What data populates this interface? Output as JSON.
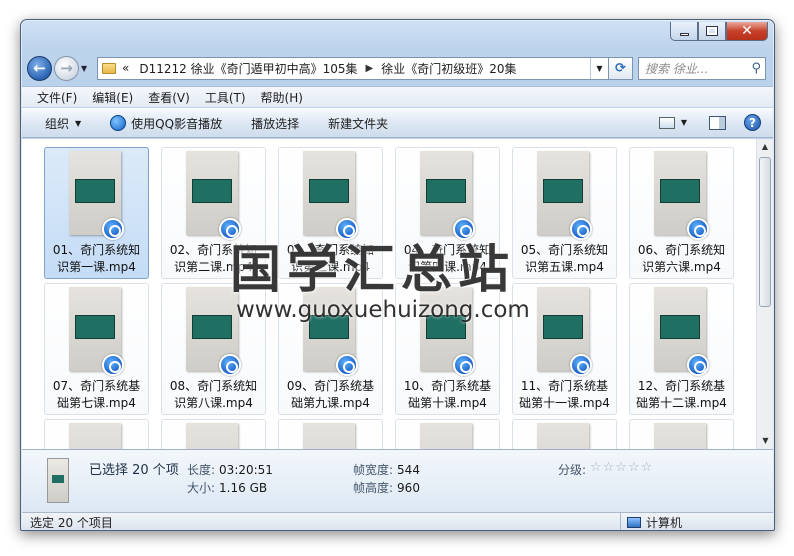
{
  "nav": {
    "breadcrumb_overflow": "«",
    "crumbs": [
      "D11212 徐业《奇门遁甲初中高》105集",
      "徐业《奇门初级班》20集"
    ],
    "search_placeholder": "搜索 徐业..."
  },
  "menu": [
    "文件(F)",
    "编辑(E)",
    "查看(V)",
    "工具(T)",
    "帮助(H)"
  ],
  "toolbar": {
    "organize": "组织",
    "play_qq": "使用QQ影音播放",
    "play_selected": "播放选择",
    "new_folder": "新建文件夹"
  },
  "files": [
    {
      "name": "01、奇门系统知识第一课.mp4",
      "selected": true
    },
    {
      "name": "02、奇门系统知识第二课.mp4",
      "selected": true
    },
    {
      "name": "03、奇门系统知识第三课.mp4",
      "selected": true
    },
    {
      "name": "04、奇门系统知识第四课.mp4",
      "selected": true
    },
    {
      "name": "05、奇门系统知识第五课.mp4",
      "selected": true
    },
    {
      "name": "06、奇门系统知识第六课.mp4",
      "selected": true
    },
    {
      "name": "07、奇门系统基础第七课.mp4",
      "selected": true
    },
    {
      "name": "08、奇门系统知识第八课.mp4",
      "selected": true
    },
    {
      "name": "09、奇门系统基础第九课.mp4",
      "selected": true
    },
    {
      "name": "10、奇门系统基础第十课.mp4",
      "selected": true
    },
    {
      "name": "11、奇门系统基础第十一课.mp4",
      "selected": true
    },
    {
      "name": "12、奇门系统基础第十二课.mp4",
      "selected": true
    },
    {
      "name": "",
      "selected": true
    },
    {
      "name": "",
      "selected": true
    },
    {
      "name": "",
      "selected": true
    },
    {
      "name": "",
      "selected": true
    },
    {
      "name": "",
      "selected": true
    },
    {
      "name": "",
      "selected": true
    }
  ],
  "watermark": {
    "title": "国学汇总站",
    "url": "www.guoxuehuizong.com"
  },
  "details": {
    "selected_count": "已选择 20 个项",
    "length_label": "长度:",
    "length_value": "03:20:51",
    "size_label": "大小:",
    "size_value": "1.16 GB",
    "frame_width_label": "帧宽度:",
    "frame_width_value": "544",
    "frame_height_label": "帧高度:",
    "frame_height_value": "960",
    "rating_label": "分级:",
    "rating_stars": "☆☆☆☆☆"
  },
  "status": {
    "left": "选定 20 个项目",
    "right": "计算机"
  }
}
